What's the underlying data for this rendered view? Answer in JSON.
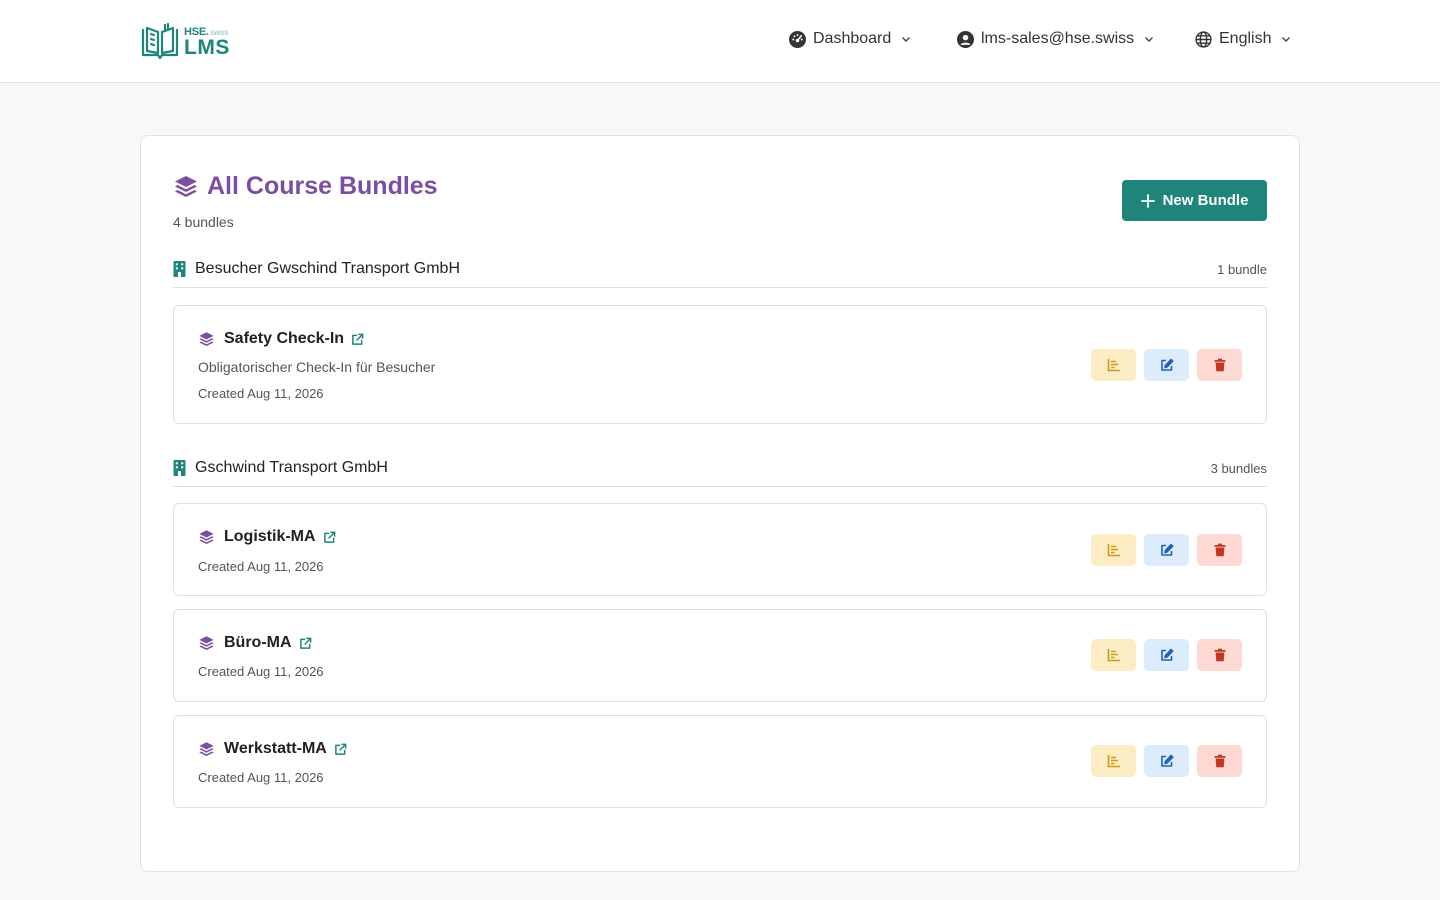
{
  "brand": {
    "hse": "HSE.",
    "suffix": "SWISS",
    "lms": "LMS"
  },
  "nav": {
    "dashboard": "Dashboard",
    "user": "lms-sales@hse.swiss",
    "language": "English"
  },
  "page": {
    "title": "All Course Bundles",
    "count": "4 bundles",
    "new_button": "New Bundle"
  },
  "groups": [
    {
      "name": "Besucher Gwschind Transport GmbH",
      "count": "1 bundle",
      "bundles": [
        {
          "title": "Safety Check-In",
          "description": "Obligatorischer Check-In für Besucher",
          "created": "Created Aug 11, 2026"
        }
      ]
    },
    {
      "name": "Gschwind Transport GmbH",
      "count": "3 bundles",
      "bundles": [
        {
          "title": "Logistik-MA",
          "created": "Created Aug 11, 2026"
        },
        {
          "title": "Büro-MA",
          "created": "Created Aug 11, 2026"
        },
        {
          "title": "Werkstatt-MA",
          "created": "Created Aug 11, 2026"
        }
      ]
    }
  ],
  "colors": {
    "brand_teal": "#1f857b",
    "title_purple": "#7b4fa0",
    "stats_bg": "#fcecc4",
    "edit_bg": "#dcecfb",
    "delete_bg": "#fcd9d3"
  },
  "icons": {
    "dashboard": "gauge-icon",
    "user": "user-circle-icon",
    "language": "globe-icon",
    "bundle": "layers-icon",
    "group": "building-icon",
    "external": "external-link-icon",
    "stats": "chart-icon",
    "edit": "edit-icon",
    "delete": "trash-icon"
  }
}
